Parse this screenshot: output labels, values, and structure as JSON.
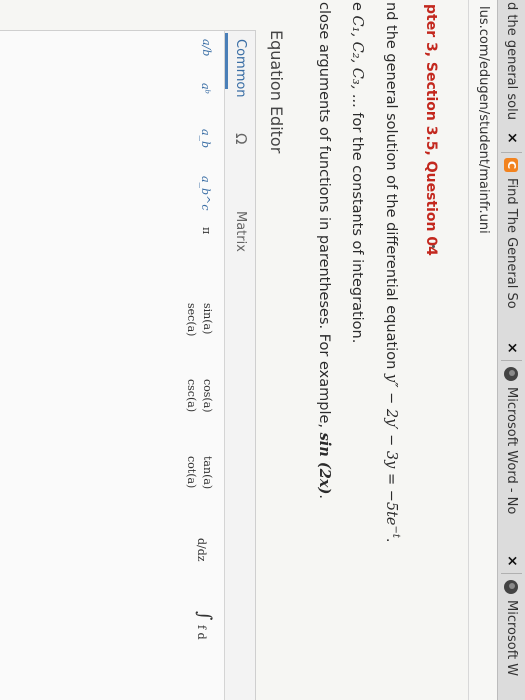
{
  "tabs": [
    {
      "title": "d the general solu",
      "favicon": "none",
      "close": "×"
    },
    {
      "title": "Find The General So",
      "favicon": "chegg-icon",
      "close": "×"
    },
    {
      "title": "Microsoft Word - No",
      "favicon": "globe-icon",
      "close": "×"
    },
    {
      "title": "Microsoft W",
      "favicon": "globe-icon"
    }
  ],
  "address": "lus.com/edugen/student/mainfr.uni",
  "question": {
    "title": "pter 3, Section 3.5, Question 04",
    "line1_text": "nd the general solution of the differential equation ",
    "line1_math": "y″ − 2y′ − 3y = −5te",
    "line1_exp": "−t",
    "line1_end": ".",
    "line2_pre": "e ",
    "line2_math": "C₁, C₂, C₃, ...",
    "line2_post": " for the constants of integration.",
    "line3_text": "close arguments of functions in parentheses. For example, ",
    "line3_math": "sin (2x)",
    "line3_end": "."
  },
  "equation_editor": {
    "title": "Equation Editor",
    "tabs": [
      "Common",
      "Ω",
      "Matrix"
    ],
    "active_tab": "Common",
    "symbols": {
      "frac": "a/b",
      "power": "aᵇ",
      "subscript": "a_b",
      "subsup": "a_b^c",
      "pi": "π",
      "sin": "sin(a)",
      "sec": "sec(a)",
      "cos": "cos(a)",
      "csc": "csc(a)",
      "tan": "tan(a)",
      "cot": "cot(a)",
      "deriv": "d/dz",
      "integral": "∫",
      "integral_label": "f d"
    }
  },
  "colors": {
    "question_title": "#c3281e",
    "editor_accent": "#3a6ea5",
    "chegg_orange": "#f2831f"
  }
}
